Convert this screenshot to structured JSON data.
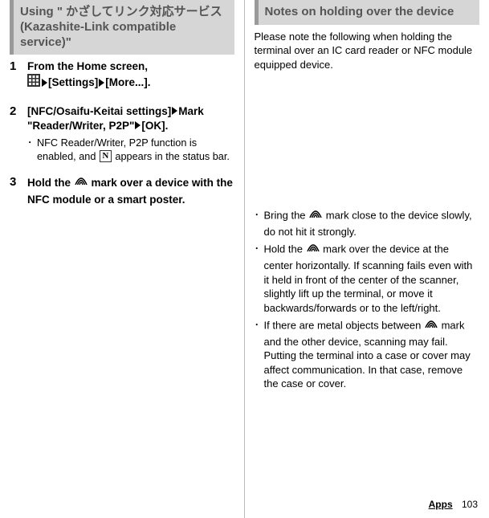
{
  "left": {
    "header": "Using \" かざしてリンク対応サービス (Kazashite-Link compatible service)\"",
    "steps": [
      {
        "num": "1",
        "title_before": "From the Home screen, ",
        "title_mid1": "[Settings]",
        "title_mid2": "[More...].",
        "sub": null
      },
      {
        "num": "2",
        "title_full": "[NFC/Osaifu-Keitai settings]",
        "title_after1": "Mark \"Reader/Writer, P2P\"",
        "title_after2": "[OK].",
        "sub_before": "NFC Reader/Writer, P2P function is enabled, and ",
        "sub_after": " appears in the status bar."
      },
      {
        "num": "3",
        "title_before2": "Hold the ",
        "title_after3": " mark over a device with the NFC module or a smart poster.",
        "sub": null
      }
    ]
  },
  "right": {
    "header": "Notes on holding over the device",
    "intro": "Please note the following when holding the terminal over an IC card reader or NFC module equipped device.",
    "bullets": [
      {
        "before": "Bring the ",
        "after": " mark close to the device slowly, do not hit it strongly."
      },
      {
        "before": "Hold the ",
        "after": " mark over the device at the center horizontally. If scanning fails even with it held in front of the center of the scanner, slightly lift up the terminal, or move it backwards/forwards or to the left/right."
      },
      {
        "before": "If there are metal objects between ",
        "after": " mark and the other device, scanning may fail. Putting the terminal into a case or cover may affect communication. In that case, remove the case or cover."
      }
    ]
  },
  "footer": {
    "section": "Apps",
    "page": "103"
  },
  "icons": {
    "n_letter": "N"
  }
}
